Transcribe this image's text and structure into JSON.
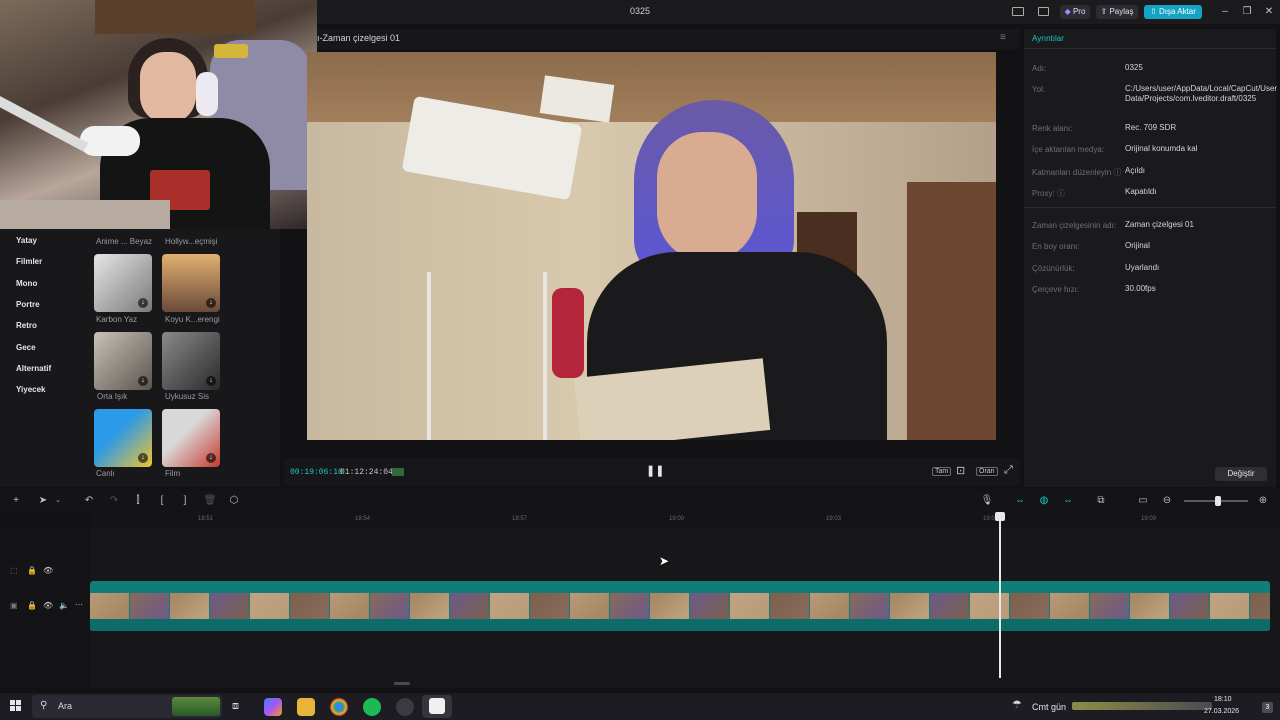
{
  "app": {
    "title": "0325",
    "pro_label": "Pro",
    "share_label": "Paylaş",
    "export_label": "Dışa Aktar"
  },
  "left_panel": {
    "categories": [
      "Yatay",
      "Filmler",
      "Mono",
      "Portre",
      "Retro",
      "Gece",
      "Alternatif",
      "Yiyecek"
    ],
    "filters_top": [
      "Anime ... Beyaz",
      "Hollyw...eçmişi"
    ],
    "filters": [
      {
        "label": "Karbon Yaz",
        "colors": [
          "#e6e6e6",
          "#7a7a7a"
        ]
      },
      {
        "label": "Koyu K...erengi",
        "colors": [
          "#e2b070",
          "#6a4a3a"
        ]
      },
      {
        "label": "Orta Işık",
        "colors": [
          "#c9c2b8",
          "#5c544e"
        ]
      },
      {
        "label": "Uykusuz Sis",
        "colors": [
          "#8a8a8a",
          "#2a2a2a"
        ]
      },
      {
        "label": "Canlı",
        "colors": [
          "#2b9ae8",
          "#f2c230"
        ]
      },
      {
        "label": "Film",
        "colors": [
          "#d8d8d8",
          "#c8392e"
        ]
      }
    ]
  },
  "player": {
    "title": "ı-Zaman çizelgesi 01",
    "current_time": "00:19:06:10",
    "total_time": "01:12:24:04",
    "full_label": "Tam",
    "ratio_label": "Oran"
  },
  "details": {
    "heading": "Ayrıntılar",
    "rows": [
      {
        "key": "Adı:",
        "value": "0325"
      },
      {
        "key": "Yol:",
        "value": "C:/Users/user/AppData/Local/CapCut/User Data/Projects/com.lveditor.draft/0325"
      },
      {
        "key": "Renk alanı:",
        "value": "Rec. 709 SDR"
      },
      {
        "key": "İçe aktarılan medya:",
        "value": "Orijinal konumda kal"
      },
      {
        "key": "Katmanları düzenleyin ⓘ",
        "value": "Açıldı"
      },
      {
        "key": "Proxy: ⓘ",
        "value": "Kapatıldı"
      },
      {
        "key": "Zaman çizelgesinin adı:",
        "value": "Zaman çizelgesi 01"
      },
      {
        "key": "En boy oranı:",
        "value": "Orijinal"
      },
      {
        "key": "Çözünürlük:",
        "value": "Uyarlandı"
      },
      {
        "key": "Çerçeve hızı:",
        "value": "30.00fps"
      }
    ],
    "change_button": "Değiştir"
  },
  "timeline": {
    "ruler": [
      "18:51",
      "18:54",
      "18:57",
      "19:00",
      "19:03",
      "19:06",
      "19:09"
    ]
  },
  "taskbar": {
    "search_label": "Ara",
    "notification": "Cmt gün",
    "time": "18:10",
    "date": "27.03.2026",
    "badge": "3"
  },
  "colors": {
    "accent": "#1fc8c0",
    "export": "#15a3c4",
    "clip": "#0f7d78"
  }
}
